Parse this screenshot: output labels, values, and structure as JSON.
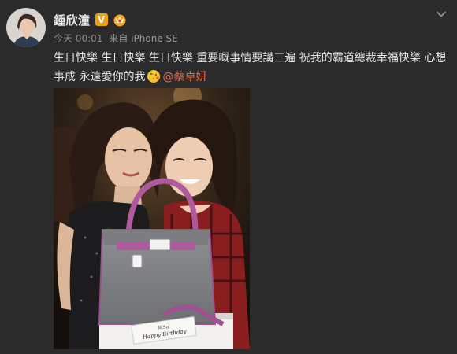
{
  "post": {
    "author": "鍾欣潼",
    "verified_mark": "V",
    "time": "今天 00:01",
    "source": "来自 iPhone SE",
    "text_main": "生日快樂 生日快樂 生日快樂 重要嘅事情要講三遍 祝我的霸道總裁幸福快樂 心想事成 永遠愛你的我",
    "mention": "@蔡卓妍",
    "photo_cake_card_text": "Happy Birthday",
    "photo_cake_card_name": "阿Sa"
  },
  "colors": {
    "background": "#2b2b2b",
    "text": "#e6e6e6",
    "meta": "#8a8a8a",
    "mention": "#e8704a",
    "verified": "#f2a200"
  },
  "icons": {
    "chevron": "chevron-down-icon",
    "verified": "verified-v-icon",
    "member": "member-crown-icon",
    "emoji": "kiss-emoji-icon"
  }
}
